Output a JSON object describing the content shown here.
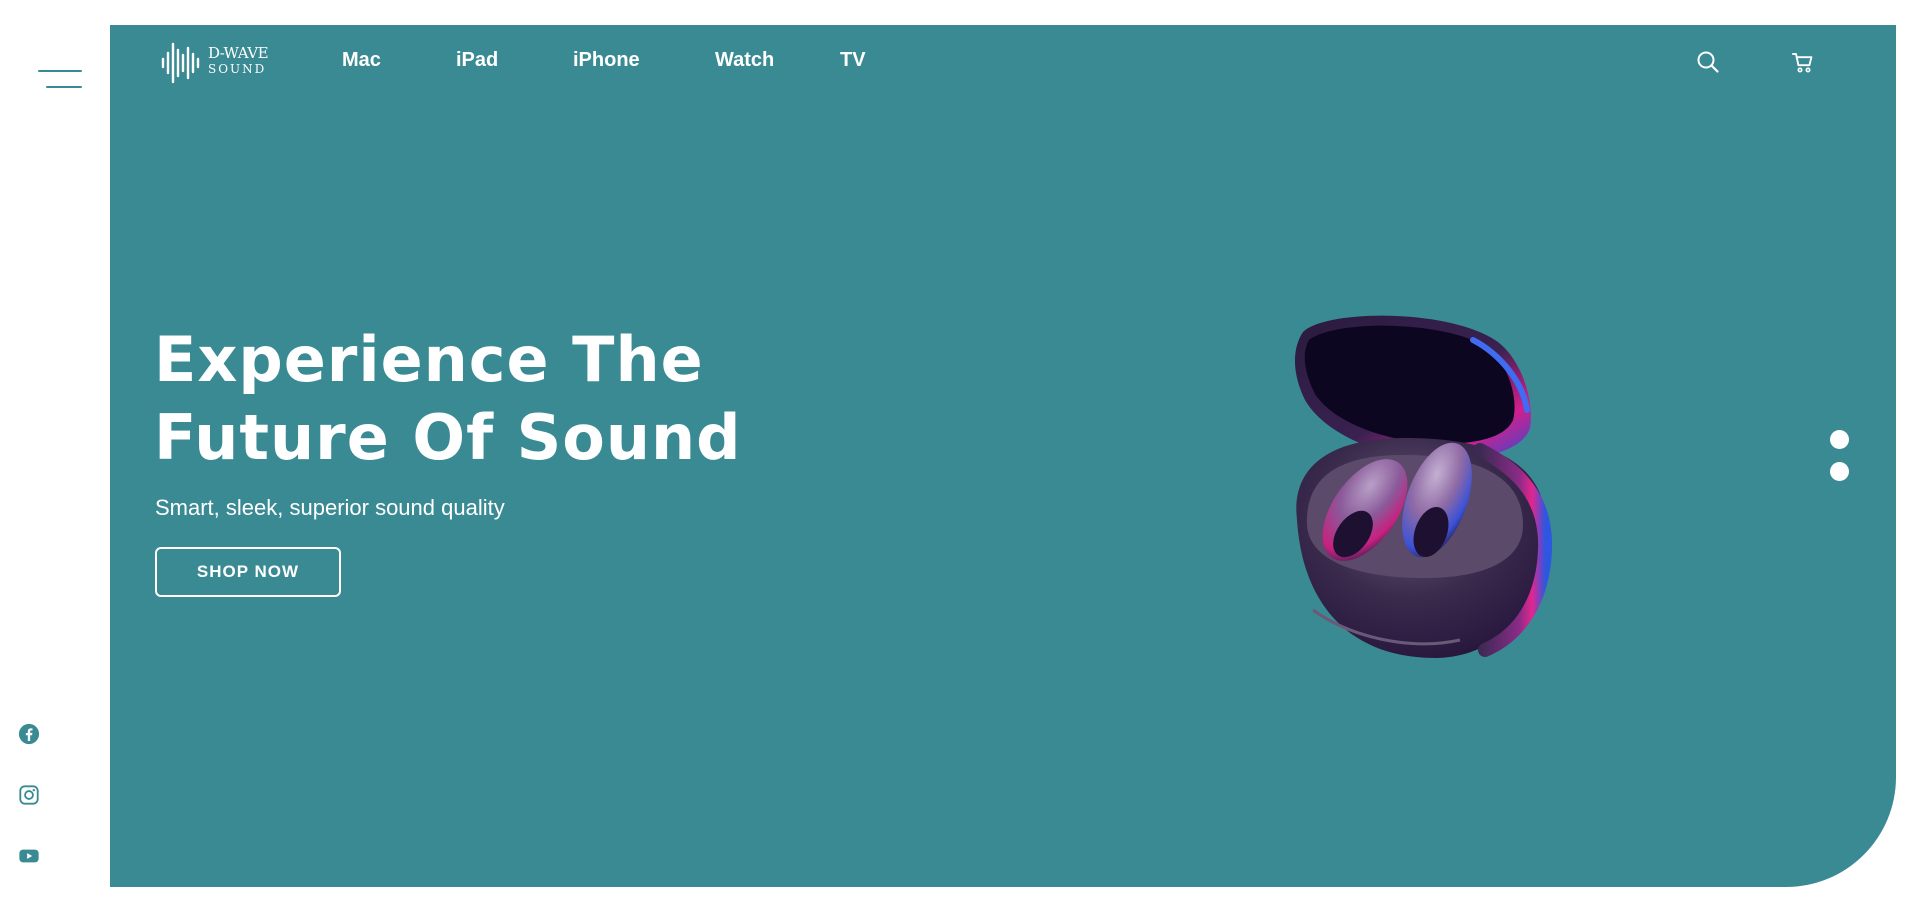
{
  "brand": {
    "logo_top": "D-WAVE",
    "logo_bottom": "SOUND"
  },
  "nav": {
    "items": [
      {
        "label": "Mac"
      },
      {
        "label": "iPad"
      },
      {
        "label": "iPhone"
      },
      {
        "label": "Watch"
      },
      {
        "label": "TV"
      }
    ]
  },
  "header_icons": [
    "search-icon",
    "cart-icon"
  ],
  "hero": {
    "headline_line1": "Experience The",
    "headline_line2": "Future Of Sound",
    "subheadline": "Smart, sleek, superior sound quality",
    "cta_label": "SHOP NOW",
    "product_image": "wireless-earbuds-case",
    "slide_count": 2
  },
  "social": [
    "facebook-icon",
    "instagram-icon",
    "youtube-icon"
  ],
  "colors": {
    "primary": "#3a8a94",
    "text_on_primary": "#ffffff",
    "background": "#ffffff"
  }
}
